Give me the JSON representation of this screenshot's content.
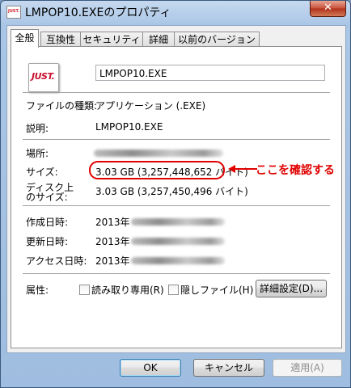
{
  "window": {
    "title": "LMPOP10.EXEのプロパティ",
    "close_label": "✕",
    "icon_logo": "JUST."
  },
  "tabs": [
    {
      "label": "全般",
      "active": true
    },
    {
      "label": "互換性",
      "active": false
    },
    {
      "label": "セキュリティ",
      "active": false
    },
    {
      "label": "詳細",
      "active": false
    },
    {
      "label": "以前のバージョン",
      "active": false
    }
  ],
  "general": {
    "file_name": "LMPOP10.EXE",
    "file_type_label": "ファイルの種類:",
    "file_type_value": "アプリケーション (.EXE)",
    "description_label": "説明:",
    "description_value": "LMPOP10.EXE",
    "location_label": "場所:",
    "size_label": "サイズ:",
    "size_value": "3.03 GB (3,257,448,652 バイト)",
    "size_on_disk_label_line1": "ディスク上",
    "size_on_disk_label_line2": "のサイズ:",
    "size_on_disk_value": "3.03 GB (3,257,450,496 バイト)",
    "created_label": "作成日時:",
    "created_value": "2013年",
    "modified_label": "更新日時:",
    "modified_value": "2013年",
    "accessed_label": "アクセス日時:",
    "accessed_value": "2013年",
    "attributes_label": "属性:",
    "readonly_label": "読み取り専用(R)",
    "hidden_label": "隠しファイル(H)",
    "advanced_button": "詳細設定(D)..."
  },
  "annotation": {
    "text": "ここを確認する",
    "color": "#e00000"
  },
  "buttons": {
    "ok": "OK",
    "cancel": "キャンセル",
    "apply": "適用(A)"
  }
}
